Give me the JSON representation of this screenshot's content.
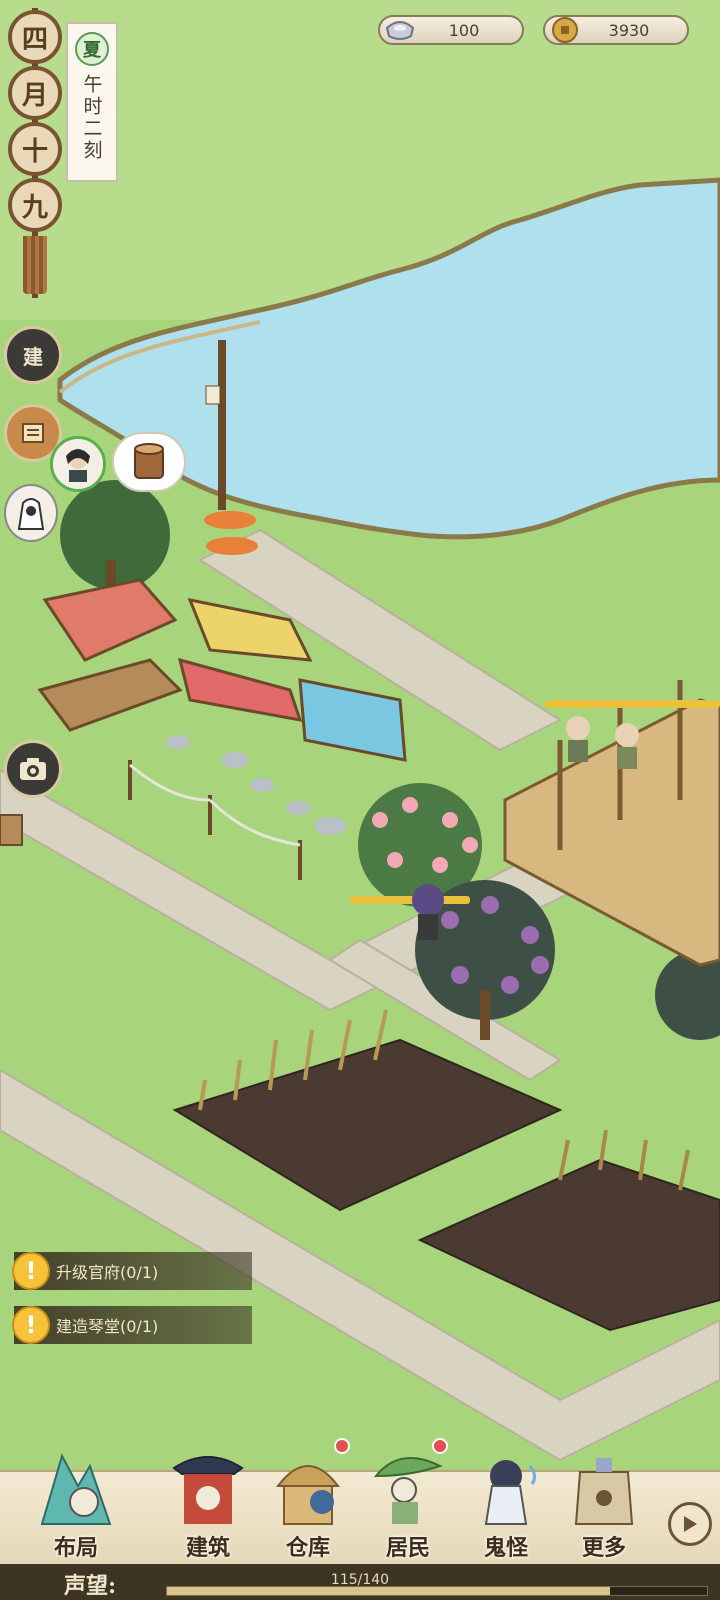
{
  "currency": {
    "silver": {
      "icon": "silver-ingot-icon",
      "value": "100"
    },
    "coins": {
      "icon": "copper-coin-icon",
      "value": "3930"
    }
  },
  "date": {
    "chars": [
      "四",
      "月",
      "十",
      "九"
    ]
  },
  "season": {
    "label": "夏",
    "time": "午时二刻"
  },
  "left_buttons": {
    "build_label": "建"
  },
  "quests": [
    {
      "text": "升级官府(0/1)"
    },
    {
      "text": "建造琴堂(0/1)"
    }
  ],
  "nav": [
    {
      "label": "布局",
      "badge": false
    },
    {
      "label": "建筑",
      "badge": false
    },
    {
      "label": "仓库",
      "badge": true
    },
    {
      "label": "居民",
      "badge": true
    },
    {
      "label": "鬼怪",
      "badge": false
    },
    {
      "label": "更多",
      "badge": false
    }
  ],
  "reputation": {
    "label": "声望:",
    "text": "115/140",
    "progress": 0.821
  },
  "colors": {
    "grass": "#9fd07a",
    "water": "#aee0ee",
    "path": "#d9d3c1",
    "soil": "#4a3a32"
  }
}
